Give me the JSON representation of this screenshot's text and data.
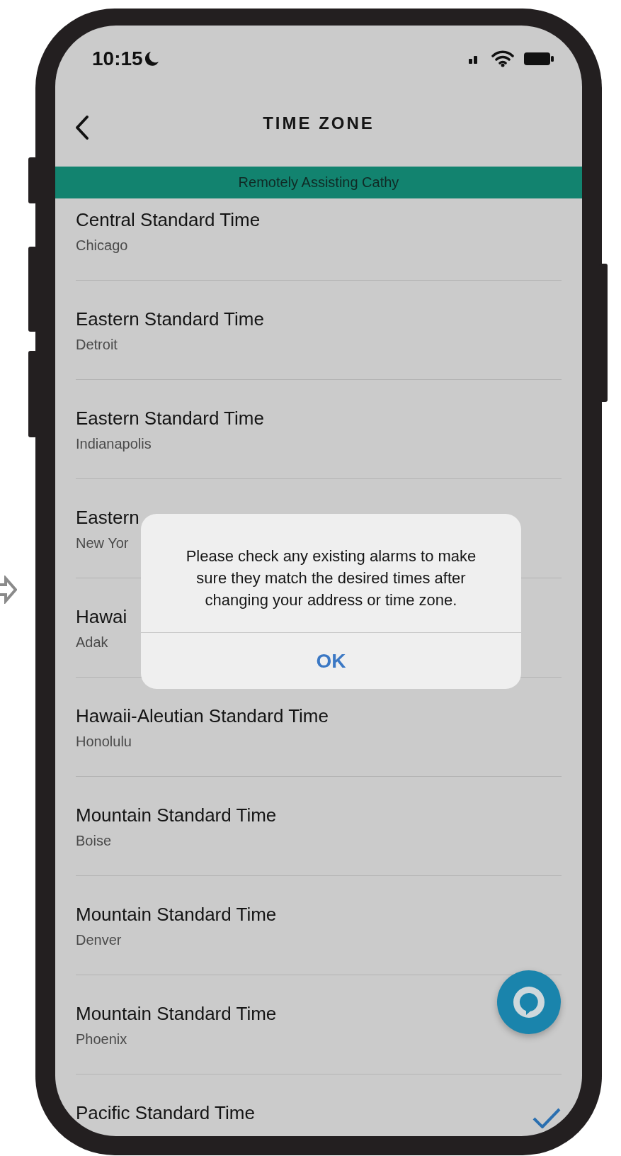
{
  "status_bar": {
    "time": "10:15"
  },
  "header": {
    "title": "TIME ZONE"
  },
  "banner": {
    "text": "Remotely Assisting Cathy"
  },
  "time_zones": [
    {
      "name": "Central Standard Time",
      "city": "Chicago",
      "selected": false
    },
    {
      "name": "Eastern Standard Time",
      "city": "Detroit",
      "selected": false
    },
    {
      "name": "Eastern Standard Time",
      "city": "Indianapolis",
      "selected": false
    },
    {
      "name": "Eastern",
      "city": "New Yor",
      "selected": false
    },
    {
      "name": "Hawai",
      "city": "Adak",
      "selected": false
    },
    {
      "name": "Hawaii-Aleutian Standard Time",
      "city": "Honolulu",
      "selected": false
    },
    {
      "name": "Mountain Standard Time",
      "city": "Boise",
      "selected": false
    },
    {
      "name": "Mountain Standard Time",
      "city": "Denver",
      "selected": false
    },
    {
      "name": "Mountain Standard Time",
      "city": "Phoenix",
      "selected": false
    },
    {
      "name": "Pacific Standard Time",
      "selected": true
    }
  ],
  "dialog": {
    "message": "Please check any existing alarms to make sure they match the desired times after changing your address or time zone.",
    "button": "OK"
  }
}
